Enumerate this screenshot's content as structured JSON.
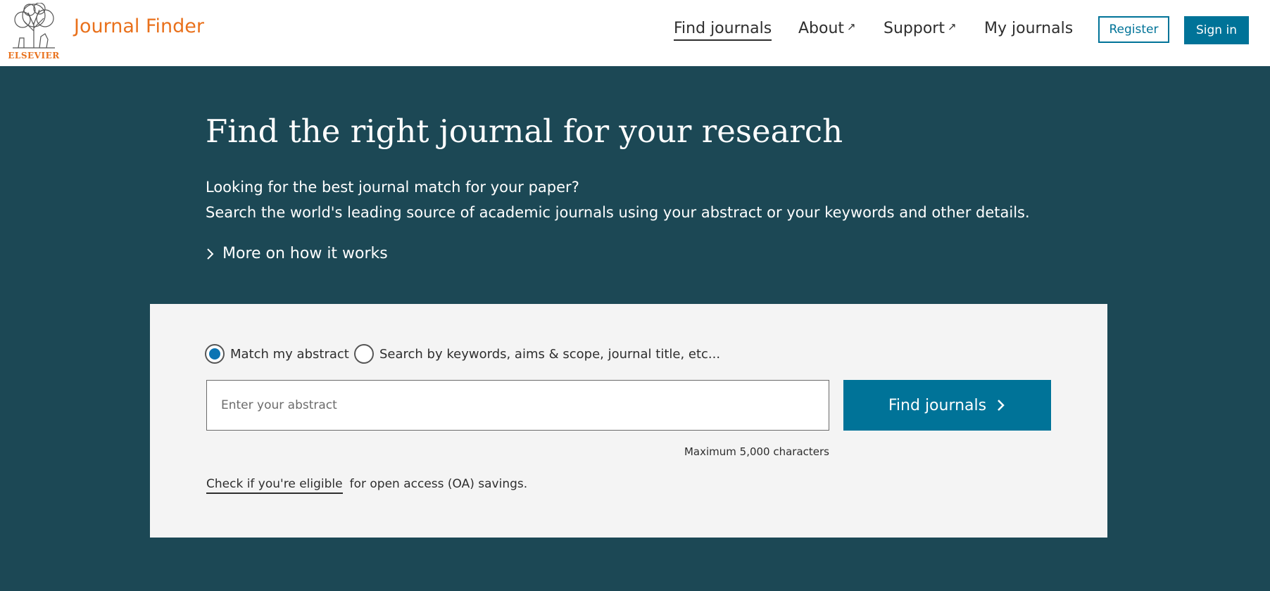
{
  "header": {
    "brand_wordmark": "ELSEVIER",
    "app_title": "Journal Finder",
    "nav": {
      "find_journals": "Find journals",
      "about": "About",
      "support": "Support",
      "my_journals": "My journals"
    },
    "register_label": "Register",
    "signin_label": "Sign in"
  },
  "hero": {
    "title": "Find the right journal for your research",
    "line1": "Looking for the best journal match for your paper?",
    "line2": "Search the world's leading source of academic journals using your abstract or your keywords and other details.",
    "more_link": "More on how it works"
  },
  "search": {
    "mode_abstract": "Match my abstract",
    "mode_keywords": "Search by keywords, aims & scope, journal title, etc...",
    "selected_mode": "Match my abstract",
    "placeholder": "Enter your abstract",
    "find_button": "Find journals",
    "max_chars": "Maximum 5,000 characters",
    "eligible_link": "Check if you're eligible",
    "oa_text": "for open access (OA) savings."
  },
  "colors": {
    "brand_orange": "#e9711c",
    "primary_blue": "#007398",
    "hero_bg": "#1c4855",
    "panel_bg": "#f4f4f4"
  },
  "icons": {
    "logo": "elsevier-tree-logo",
    "external": "arrow-up-right-icon",
    "chevron": "chevron-right-icon"
  }
}
